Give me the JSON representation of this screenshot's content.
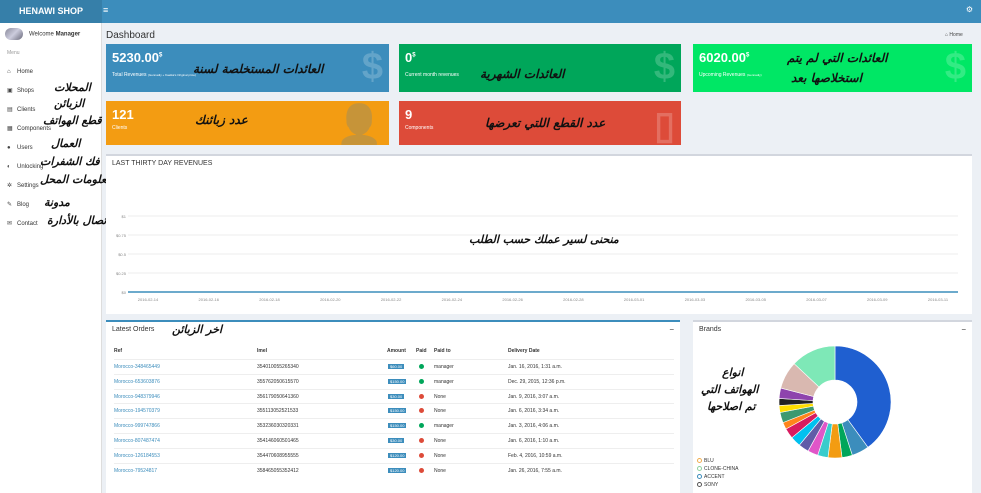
{
  "app": {
    "name": "HENAWI SHOP"
  },
  "sidebar": {
    "welcome_prefix": "Welcome",
    "user": "Manager",
    "menu_heading": "Menu",
    "items": [
      {
        "label": "Home",
        "icon": "home-icon",
        "g": "⌂"
      },
      {
        "label": "Shops",
        "icon": "shop-icon",
        "g": "▣"
      },
      {
        "label": "Clients",
        "icon": "clients-icon",
        "g": "▤"
      },
      {
        "label": "Components",
        "icon": "grid-icon",
        "g": "▦"
      },
      {
        "label": "Users",
        "icon": "users-icon",
        "g": "●"
      },
      {
        "label": "Unlocking",
        "icon": "unlock-icon",
        "g": "◐"
      },
      {
        "label": "Settings",
        "icon": "gear-icon",
        "g": "✲"
      },
      {
        "label": "Blog",
        "icon": "pencil-icon",
        "g": "✎"
      },
      {
        "label": "Contact",
        "icon": "mail-icon",
        "g": "✉"
      }
    ]
  },
  "header": {
    "title": "Dashboard",
    "crumb": "Home"
  },
  "stats": [
    {
      "value": "5230.00",
      "cur": "$",
      "label": "Total Revenues",
      "sublabel": "(Gennadiy + Kaelka's Original price)",
      "color": "#3c8dbc",
      "icon": "dollar-icon",
      "glyph": "$"
    },
    {
      "value": "0",
      "cur": "$",
      "label": "Current month revenues",
      "sublabel": "",
      "color": "#00a65a",
      "icon": "dollar-icon",
      "glyph": "$"
    },
    {
      "value": "6020.00",
      "cur": "$",
      "label": "Upcoming Revenues",
      "sublabel": "(Gennadiy)",
      "color": "#00e765",
      "icon": "dollar-icon",
      "glyph": "$"
    },
    {
      "value": "121",
      "cur": "",
      "label": "Clients",
      "sublabel": "",
      "color": "#f39c12",
      "icon": "user-icon",
      "glyph": "👤"
    },
    {
      "value": "9",
      "cur": "",
      "label": "Components",
      "sublabel": "",
      "color": "#dd4b39",
      "icon": "phone-icon",
      "glyph": "▯"
    }
  ],
  "annotations": {
    "a1": "العائدات المستخلصة لسنة",
    "a2": "العائدات الشهرية",
    "a3": "العائدات التي لم يتم",
    "a3b": "استخلاصها بعد",
    "a4": "عدد زبائنك",
    "a5": "عدد القطع اللتي تعرضها",
    "s1": "المحلات",
    "s2": "الزبائن",
    "s3": "قطع الهواتف",
    "s4": "العمال",
    "s5": "فك الشفرات",
    "s6": "تعديل معلومات المحل",
    "s7": "مدونة",
    "s8": "اتصال بالأدارة",
    "chart": "منحنى لسير عملك حسب الطلب",
    "orders": "اخر الزبائن",
    "brands1": "انواع",
    "brands2": "الهواتف التي",
    "brands3": "تم اصلاحها"
  },
  "chart_data": {
    "type": "line",
    "title": "LAST THIRTY DAY REVENUES",
    "x": [
      "2016-02-14",
      "2016-02-16",
      "2016-02-18",
      "2016-02-20",
      "2016-02-22",
      "2016-02-24",
      "2016-02-26",
      "2016-02-28",
      "2016-03-01",
      "2016-03-03",
      "2016-03-05",
      "2016-03-07",
      "2016-03-09",
      "2016-03-11"
    ],
    "y": [
      0,
      0,
      0,
      0,
      0,
      0,
      0,
      0,
      0,
      0,
      0,
      0,
      0,
      0
    ],
    "ytick": [
      "$1",
      "$0.75",
      "$0.5",
      "$0.25",
      "$0"
    ],
    "ylim": [
      0,
      1
    ]
  },
  "orders": {
    "title": "Latest Orders",
    "cols": [
      "Ref",
      "Imel",
      "Amount",
      "Paid",
      "Paid to",
      "Delivery Date"
    ],
    "rows": [
      [
        "Morocco-348465449",
        "354010055265340",
        "$60.00",
        "#00a65a",
        "manager",
        "Jan. 16, 2016, 1:31 a.m."
      ],
      [
        "Morocco-653603876",
        "355762050615570",
        "$150.00",
        "#00a65a",
        "manager",
        "Dec. 29, 2015, 12:36 p.m."
      ],
      [
        "Morocco-948379946",
        "356179050641360",
        "$30.00",
        "#dd4b39",
        "None",
        "Jan. 9, 2016, 3:07 a.m."
      ],
      [
        "Morocco-194570379",
        "355113052521533",
        "$150.00",
        "#dd4b39",
        "None",
        "Jan. 6, 2016, 3:34 a.m."
      ],
      [
        "Morocco-999747866",
        "353236030320331",
        "$150.00",
        "#00a65a",
        "manager",
        "Jan. 3, 2016, 4:06 a.m."
      ],
      [
        "Morocco-807487474",
        "354146060501465",
        "$30.00",
        "#dd4b39",
        "None",
        "Jan. 6, 2016, 1:10 a.m."
      ],
      [
        "Morocco-126184553",
        "354470608955555",
        "$120.00",
        "#dd4b39",
        "None",
        "Feb. 4, 2016, 10:59 a.m."
      ],
      [
        "Morocco-79524817",
        "358465055352412",
        "$120.00",
        "#dd4b39",
        "None",
        "Jan. 26, 2016, 7:55 a.m."
      ]
    ]
  },
  "brands": {
    "title": "Brands",
    "legend": [
      {
        "name": "BLU",
        "color": "#f0ad4e"
      },
      {
        "name": "CLONE-CHINA",
        "color": "#8fd19e"
      },
      {
        "name": "ACCENT",
        "color": "#3c8dbc"
      },
      {
        "name": "SONY",
        "color": "#555"
      }
    ],
    "pie": [
      {
        "v": 40,
        "c": "#1f5fd0"
      },
      {
        "v": 5,
        "c": "#3c8dbc"
      },
      {
        "v": 3,
        "c": "#00a65a"
      },
      {
        "v": 4,
        "c": "#f39c12"
      },
      {
        "v": 3,
        "c": "#39cccc"
      },
      {
        "v": 3,
        "c": "#e056c8"
      },
      {
        "v": 3,
        "c": "#605ca8"
      },
      {
        "v": 3,
        "c": "#00c0ef"
      },
      {
        "v": 3,
        "c": "#d81b60"
      },
      {
        "v": 2,
        "c": "#ff851b"
      },
      {
        "v": 3,
        "c": "#3d9970"
      },
      {
        "v": 2,
        "c": "#ffde00"
      },
      {
        "v": 2,
        "c": "#222"
      },
      {
        "v": 3,
        "c": "#8e44ad"
      },
      {
        "v": 8,
        "c": "#d9b8b0"
      },
      {
        "v": 13,
        "c": "#7ee8b7"
      }
    ]
  }
}
